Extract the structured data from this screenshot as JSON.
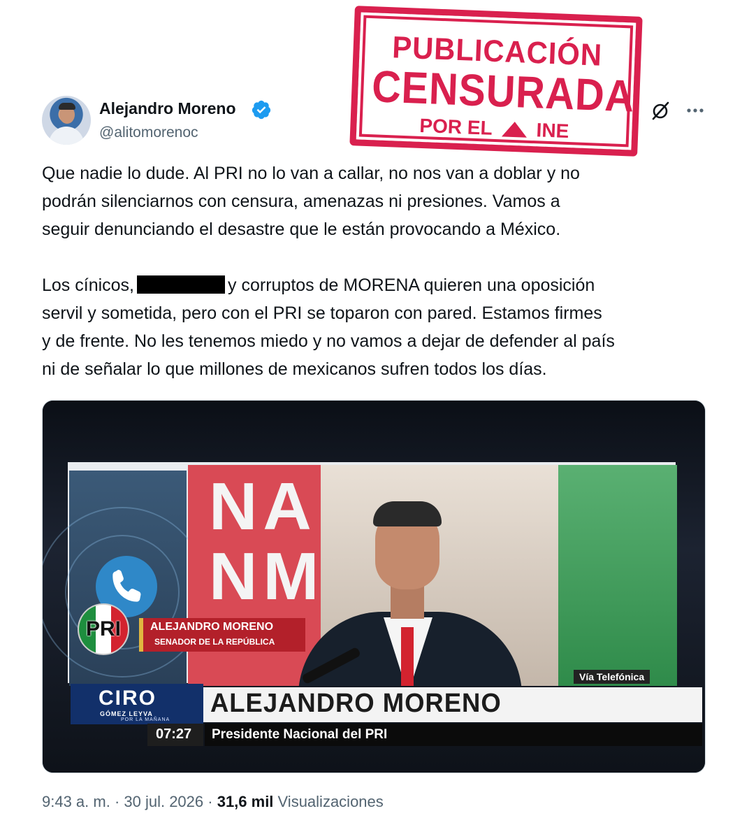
{
  "tweet": {
    "author": {
      "name": "Alejandro Moreno",
      "handle": "@alitomorenoc",
      "verified": true,
      "verified_color": "#1d9bf0"
    },
    "paragraph1": "Que nadie lo dude. Al PRI no lo van a callar, no nos van a doblar y no\npodrán silenciarnos con censura, amenazas ni presiones. Vamos a\nseguir denunciando el desastre que le están provocando a México.",
    "paragraph2_before": "Los cínicos,",
    "paragraph2_after": "y corruptos de MORENA quieren una oposición\nservil y sometida, pero con el PRI se toparon con pared. Estamos firmes\ny de frente. No les tenemos miedo y no vamos a dejar de defender al país\nni de señalar lo que millones de mexicanos sufren todos los días.",
    "timestamp": "9:43 a. m. · 30 jul. 2026 · ",
    "views_count": "31,6 mil",
    "views_label": " Visualizaciones"
  },
  "stamp": {
    "line1": "PUBLICACIÓN",
    "line2": "CENSURADA",
    "line3_left": "POR EL",
    "line3_right": "INE",
    "color": "#d9204e"
  },
  "media": {
    "logo_text": "PRI",
    "name_tag_title": "ALEJANDRO MORENO",
    "name_tag_subtitle": "SENADOR DE LA REPÚBLICA",
    "via": "Vía Telefónica",
    "lower_third_name": "ALEJANDRO MORENO",
    "brand_name": "CIRO",
    "brand_sub": "GÓMEZ LEYVA",
    "brand_sub2": "POR LA MAÑANA",
    "time": "07:27",
    "role": "Presidente Nacional del PRI",
    "backdrop_letters": "NA\nNM"
  },
  "icons": {
    "verified": "verified-badge-icon",
    "grok": "grok-icon",
    "more": "more-options-icon",
    "phone": "phone-icon"
  }
}
